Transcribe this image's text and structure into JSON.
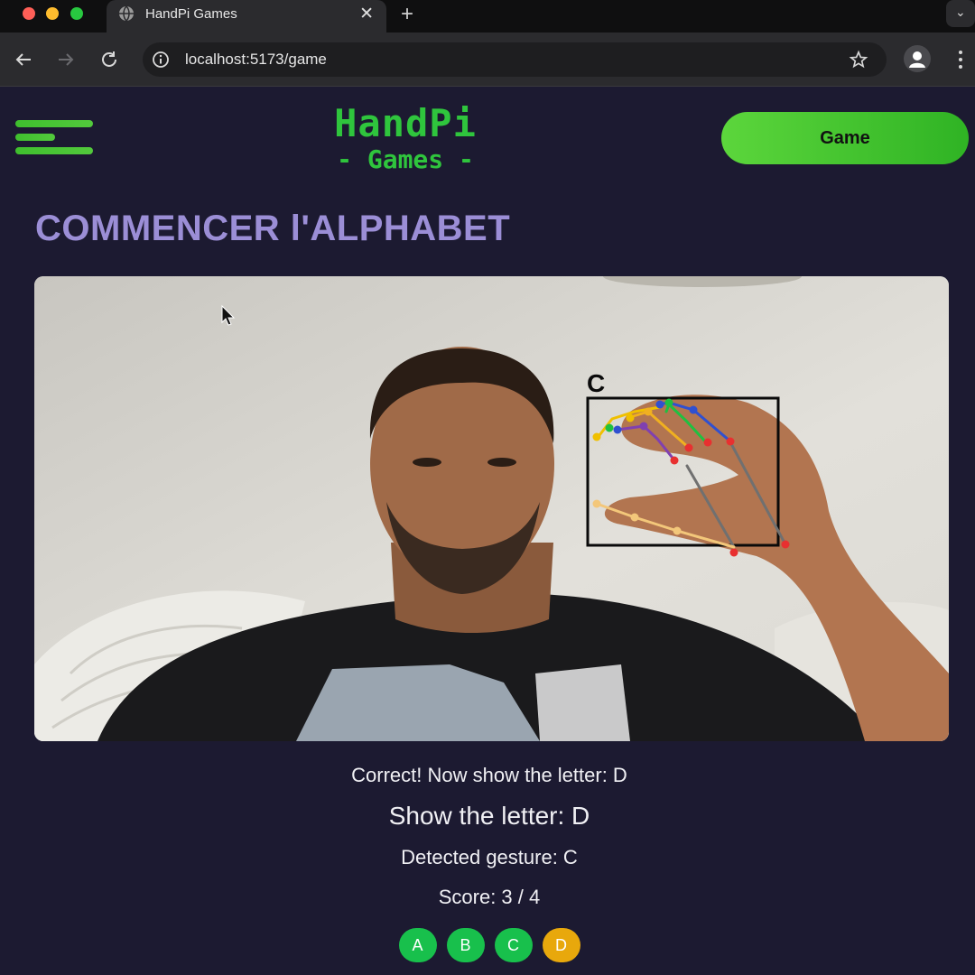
{
  "browser": {
    "tab_title": "HandPi Games",
    "tab_close": "✕",
    "new_tab": "+",
    "url": "localhost:5173/game"
  },
  "header": {
    "logo_line1": "HandPi",
    "logo_line2": "- Games -",
    "game_button": "Game"
  },
  "main": {
    "title": "COMMENCER l'ALPHABET",
    "webcam": {
      "detected_box_label": "C"
    },
    "messages": {
      "correct": "Correct! Now show the letter: D",
      "show": "Show the letter: D",
      "detected": "Detected gesture: C",
      "score": "Score: 3 / 4"
    },
    "letters": [
      {
        "label": "A",
        "status": "done",
        "color": "#18c04c"
      },
      {
        "label": "B",
        "status": "done",
        "color": "#18c04c"
      },
      {
        "label": "C",
        "status": "done",
        "color": "#18c04c"
      },
      {
        "label": "D",
        "status": "current",
        "color": "#e8a80c"
      }
    ]
  },
  "colors": {
    "background": "#1c1a31",
    "accent_green": "#2fc53d",
    "title_purple": "#9b8ed6"
  }
}
